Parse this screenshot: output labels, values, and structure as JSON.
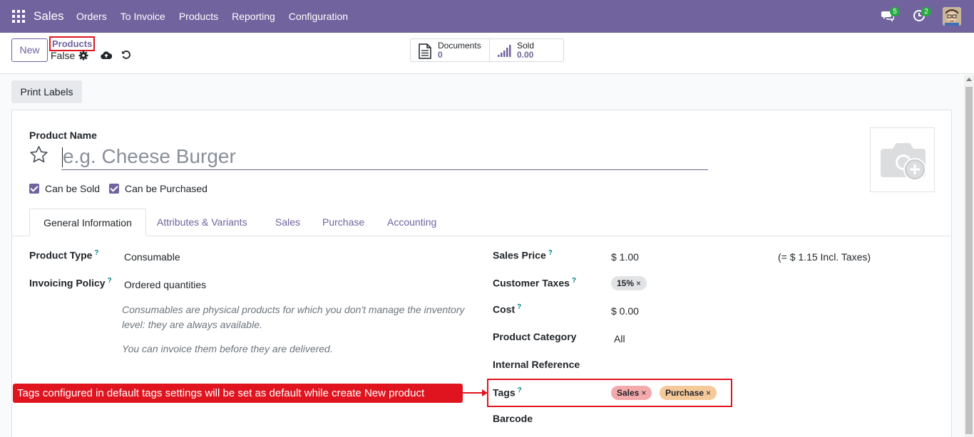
{
  "navbar": {
    "brand": "Sales",
    "menu": [
      "Orders",
      "To Invoice",
      "Products",
      "Reporting",
      "Configuration"
    ],
    "messages_count": "5",
    "activities_count": "2"
  },
  "control_panel": {
    "new_label": "New",
    "breadcrumb": "Products",
    "record_name": "False",
    "smart_buttons": [
      {
        "label": "Documents",
        "value": "0"
      },
      {
        "label": "Sold",
        "value": "0.00"
      }
    ]
  },
  "actions": {
    "print_labels": "Print Labels"
  },
  "form": {
    "product_name_label": "Product Name",
    "product_name_placeholder": "e.g. Cheese Burger",
    "can_be_sold": "Can be Sold",
    "can_be_purchased": "Can be Purchased",
    "tabs": [
      "General Information",
      "Attributes & Variants",
      "Sales",
      "Purchase",
      "Accounting"
    ],
    "left": {
      "product_type_label": "Product Type",
      "product_type_value": "Consumable",
      "invoicing_policy_label": "Invoicing Policy",
      "invoicing_policy_value": "Ordered quantities",
      "help_1": "Consumables are physical products for which you don't manage the inventory level: they are always available.",
      "help_2": "You can invoice them before they are delivered."
    },
    "right": {
      "sales_price_label": "Sales Price",
      "sales_price_value": "$ 1.00",
      "incl_taxes": "(= $ 1.15 Incl. Taxes)",
      "customer_taxes_label": "Customer Taxes",
      "customer_taxes_tag": "15%",
      "cost_label": "Cost",
      "cost_value": "$ 0.00",
      "product_category_label": "Product Category",
      "product_category_value": "All",
      "internal_reference_label": "Internal Reference",
      "tags_label": "Tags",
      "tags": [
        "Sales",
        "Purchase"
      ],
      "barcode_label": "Barcode"
    },
    "help_mark": "?"
  },
  "annotation": {
    "text": "Tags configured in default tags settings will be set as default while create New product"
  },
  "colors": {
    "primary": "#71639e",
    "annotation_red": "#e0141f",
    "tag_sales": "#f4a9ab",
    "tag_purchase": "#f5c99a"
  }
}
